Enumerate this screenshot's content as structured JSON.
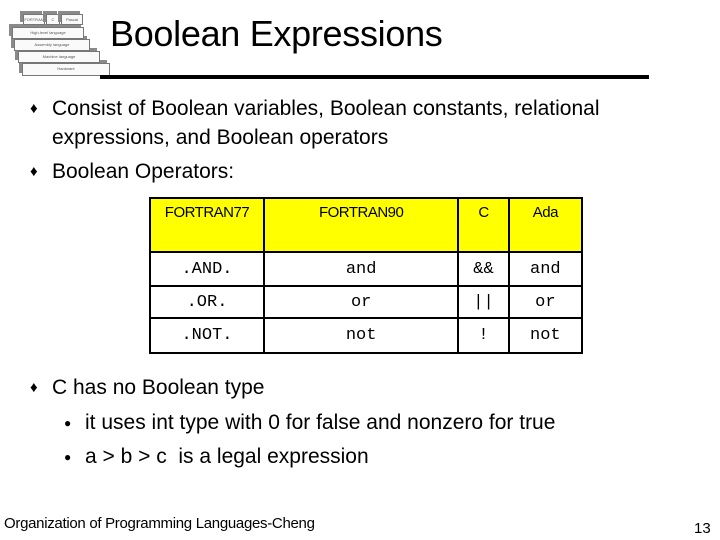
{
  "slide": {
    "title": "Boolean Expressions",
    "logo": {
      "icon": "language-pyramid-icon",
      "layers": [
        "FORTRAN",
        "C",
        "Pascal",
        "High-level language",
        "Assembly language",
        "Machine language",
        "Hardware"
      ]
    },
    "bullets": [
      {
        "marker": "♦",
        "lines": [
          "Consist of Boolean variables, Boolean constants, relational",
          "expressions, and Boolean operators"
        ]
      },
      {
        "marker": "♦",
        "lines": [
          "Boolean Operators:"
        ]
      }
    ],
    "operators_table": {
      "headers": [
        "FORTRAN77",
        "FORTRAN90",
        "C",
        "Ada"
      ],
      "rows": [
        [
          ".AND.",
          "and",
          "&&",
          "and"
        ],
        [
          ".OR.",
          "or",
          "||",
          "or"
        ],
        [
          ".NOT.",
          "not",
          "!",
          "not"
        ]
      ],
      "header_color": "#ffff00"
    },
    "bullet3": {
      "marker": "♦",
      "text": "C has no Boolean type",
      "sub": [
        {
          "marker": "●",
          "text": "it uses int type with 0 for false and nonzero for true"
        },
        {
          "marker": "●",
          "text": "a > b > c  is a legal expression"
        }
      ]
    },
    "footer": "Organization of Programming Languages-Cheng",
    "page_number": "13"
  }
}
